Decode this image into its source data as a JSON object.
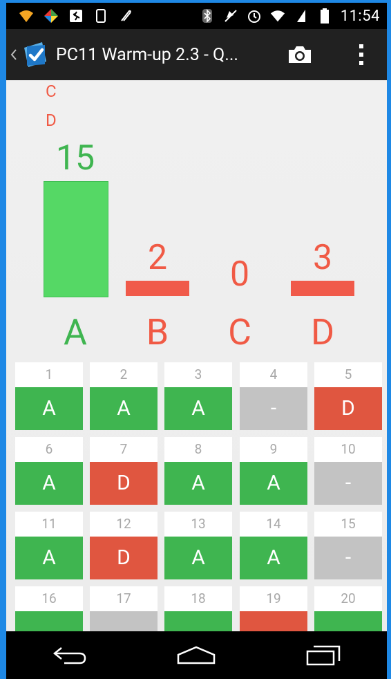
{
  "status_bar": {
    "time": "11:54",
    "icons_left": [
      "wifi-icon",
      "diamond-app-icon",
      "runner-icon",
      "phone-icon",
      "pen-icon"
    ],
    "icons_right": [
      "bluetooth-icon",
      "mute-icon",
      "alarm-icon",
      "wifi-signal-icon",
      "cell-signal-icon",
      "battery-icon"
    ]
  },
  "app_bar": {
    "title": "PC11 Warm-up 2.3 - Q...",
    "actions": [
      "camera-icon",
      "overflow-menu-icon"
    ]
  },
  "histogram": {
    "correct_letters": [
      "C",
      "D"
    ],
    "bars": [
      {
        "label": "A",
        "value": "15",
        "count": 15,
        "color": "#55d865",
        "text_color": "#3fb550"
      },
      {
        "label": "B",
        "value": "2",
        "count": 2,
        "color": "#f05a4a",
        "text_color": "#f05a45"
      },
      {
        "label": "C",
        "value": "0",
        "count": 0,
        "color": "#f05a4a",
        "text_color": "#f05a45"
      },
      {
        "label": "D",
        "value": "3",
        "count": 3,
        "color": "#f05a4a",
        "text_color": "#f05a45"
      }
    ]
  },
  "responses": [
    {
      "num": "1",
      "answer": "A",
      "status": "green"
    },
    {
      "num": "2",
      "answer": "A",
      "status": "green"
    },
    {
      "num": "3",
      "answer": "A",
      "status": "green"
    },
    {
      "num": "4",
      "answer": "-",
      "status": "gray"
    },
    {
      "num": "5",
      "answer": "D",
      "status": "red"
    },
    {
      "num": "6",
      "answer": "A",
      "status": "green"
    },
    {
      "num": "7",
      "answer": "D",
      "status": "red"
    },
    {
      "num": "8",
      "answer": "A",
      "status": "green"
    },
    {
      "num": "9",
      "answer": "A",
      "status": "green"
    },
    {
      "num": "10",
      "answer": "-",
      "status": "gray"
    },
    {
      "num": "11",
      "answer": "A",
      "status": "green"
    },
    {
      "num": "12",
      "answer": "D",
      "status": "red"
    },
    {
      "num": "13",
      "answer": "A",
      "status": "green"
    },
    {
      "num": "14",
      "answer": "A",
      "status": "green"
    },
    {
      "num": "15",
      "answer": "-",
      "status": "gray"
    },
    {
      "num": "16",
      "answer": "",
      "status": "green"
    },
    {
      "num": "17",
      "answer": "",
      "status": "gray"
    },
    {
      "num": "18",
      "answer": "",
      "status": "green"
    },
    {
      "num": "19",
      "answer": "",
      "status": "red"
    },
    {
      "num": "20",
      "answer": "",
      "status": "green"
    }
  ],
  "nav_bar": {
    "buttons": [
      "back-icon",
      "home-icon",
      "recents-icon"
    ]
  }
}
